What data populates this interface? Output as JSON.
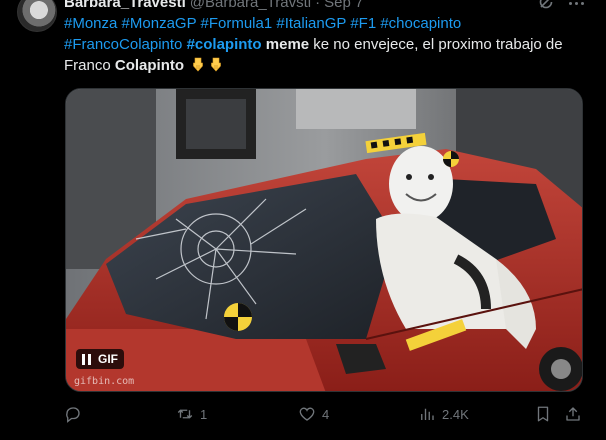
{
  "author": {
    "display_name": "Barbara_Travesti",
    "handle": "@Barbara_Travsti",
    "separator": "·",
    "date": "Sep 7"
  },
  "tweet": {
    "hashtags_line1": [
      "#Monza",
      "#MonzaGP",
      "#Formula1",
      "#ItalianGP",
      "#F1",
      "#chocapinto"
    ],
    "hashtag_line2_a": "#FrancoColapinto",
    "hashtag_line2_b": "#colapinto",
    "bold_meme": "meme",
    "text_rest": "ke no envejece, el proximo trabajo de",
    "text_franco": "Franco",
    "bold_colapinto": "Colapinto"
  },
  "media": {
    "badge_label": "GIF",
    "watermark": "gifbin.com"
  },
  "actions": {
    "reply_count": "",
    "retweet_count": "1",
    "like_count": "4",
    "view_count": "2.4K"
  },
  "icons": {
    "emoji": "backhand-index-pointing-down",
    "more": "more-dots-icon",
    "grok": "grok-icon"
  }
}
